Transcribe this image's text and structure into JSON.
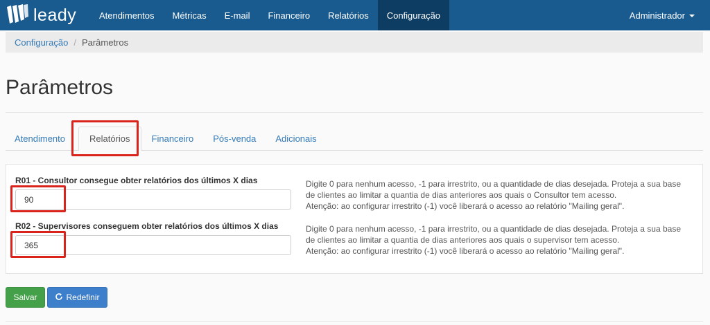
{
  "brand": {
    "name": "leady",
    "icon": "leady-logo-icon"
  },
  "nav": {
    "items": [
      {
        "label": "Atendimentos"
      },
      {
        "label": "Métricas"
      },
      {
        "label": "E-mail"
      },
      {
        "label": "Financeiro"
      },
      {
        "label": "Relatórios"
      },
      {
        "label": "Configuração",
        "active": true
      }
    ],
    "user": "Administrador"
  },
  "breadcrumb": {
    "parent": "Configuração",
    "separator": "/",
    "current": "Parâmetros"
  },
  "page": {
    "title": "Parâmetros"
  },
  "tabs": [
    {
      "label": "Atendimento"
    },
    {
      "label": "Relatórios",
      "active": true
    },
    {
      "label": "Financeiro"
    },
    {
      "label": "Pós-venda"
    },
    {
      "label": "Adicionais"
    }
  ],
  "params": [
    {
      "label": "R01 - Consultor consegue obter relatórios dos últimos X dias",
      "value": "90",
      "help_line1": "Digite 0 para nenhum acesso, -1 para irrestrito, ou a quantidade de dias desejada. Proteja a sua base",
      "help_line2": "de clientes ao limitar a quantia de dias anteriores aos quais o Consultor tem acesso.",
      "help_line3": "Atenção: ao configurar irrestrito (-1) você liberará o acesso ao relatório \"Mailing geral\"."
    },
    {
      "label": "R02 - Supervisores conseguem obter relatórios dos últimos X dias",
      "value": "365",
      "help_line1": "Digite 0 para nenhum acesso, -1 para irrestrito, ou a quantidade de dias desejada. Proteja a sua base",
      "help_line2": "de clientes ao limitar a quantia de dias anteriores aos quais o supervisor tem acesso.",
      "help_line3": "Atenção: ao configurar irrestrito (-1) você liberará o acesso ao relatório \"Mailing geral\"."
    }
  ],
  "actions": {
    "save": "Salvar",
    "reset": "Redefinir",
    "reset_icon": "refresh-icon"
  },
  "colors": {
    "navbar": "#1a5b8f",
    "nav_active": "#0e3d63",
    "link": "#337ab7",
    "save": "#45a04a",
    "reset": "#3d7fcb",
    "highlight": "#d9231b"
  }
}
